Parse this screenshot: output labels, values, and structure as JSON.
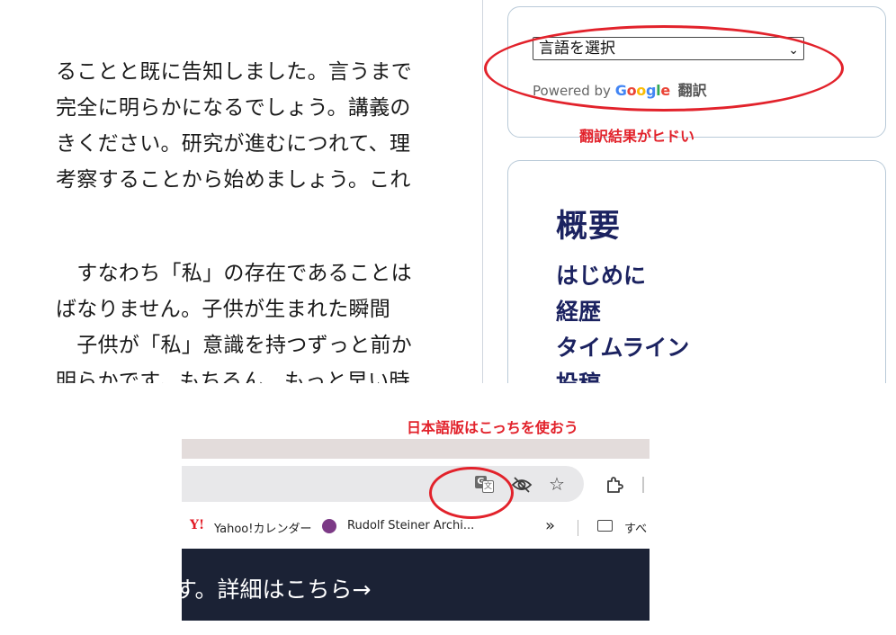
{
  "article": {
    "lines_top": [
      "ることと既に告知しました。言うまで",
      "完全に明らかになるでしょう。講義の",
      "きください。研究が進むにつれて、理",
      "考察することから始めましょう。これ"
    ],
    "lines_bottom": [
      "　すなわち「私」の存在であることは",
      "ばなりません。子供が生まれた瞬間",
      "　子供が「私」意識を持つずっと前か",
      "明らかです。もちろん、もっと早い時"
    ]
  },
  "translate_widget": {
    "select_value": "言語を選択",
    "powered_by": "Powered by",
    "google_letters": [
      "G",
      "o",
      "o",
      "g",
      "l",
      "e"
    ],
    "google_colors": [
      "#4285F4",
      "#EA4335",
      "#FBBC05",
      "#4285F4",
      "#34A853",
      "#EA4335"
    ],
    "translate_label": "翻訳"
  },
  "summary": {
    "title": "概要",
    "links": [
      "はじめに",
      "経歴",
      "タイムライン",
      "投稿"
    ],
    "link_color": "#1b2260"
  },
  "annotations": {
    "top_note": "翻訳結果がヒドい",
    "bottom_note": "日本語版はこっちを使おう",
    "color": "#e2222b"
  },
  "browser": {
    "icons": [
      "google-translate-icon",
      "eye-off-icon",
      "star-icon",
      "extensions-icon"
    ],
    "bookmarks": [
      {
        "icon_text": "Y!",
        "label": "Yahoo!カレンダー"
      },
      {
        "label": "Rudolf Steiner Archi..."
      }
    ],
    "more_label": "»",
    "folder_label": "すべ",
    "banner_text": "す。詳細はこちら→"
  }
}
